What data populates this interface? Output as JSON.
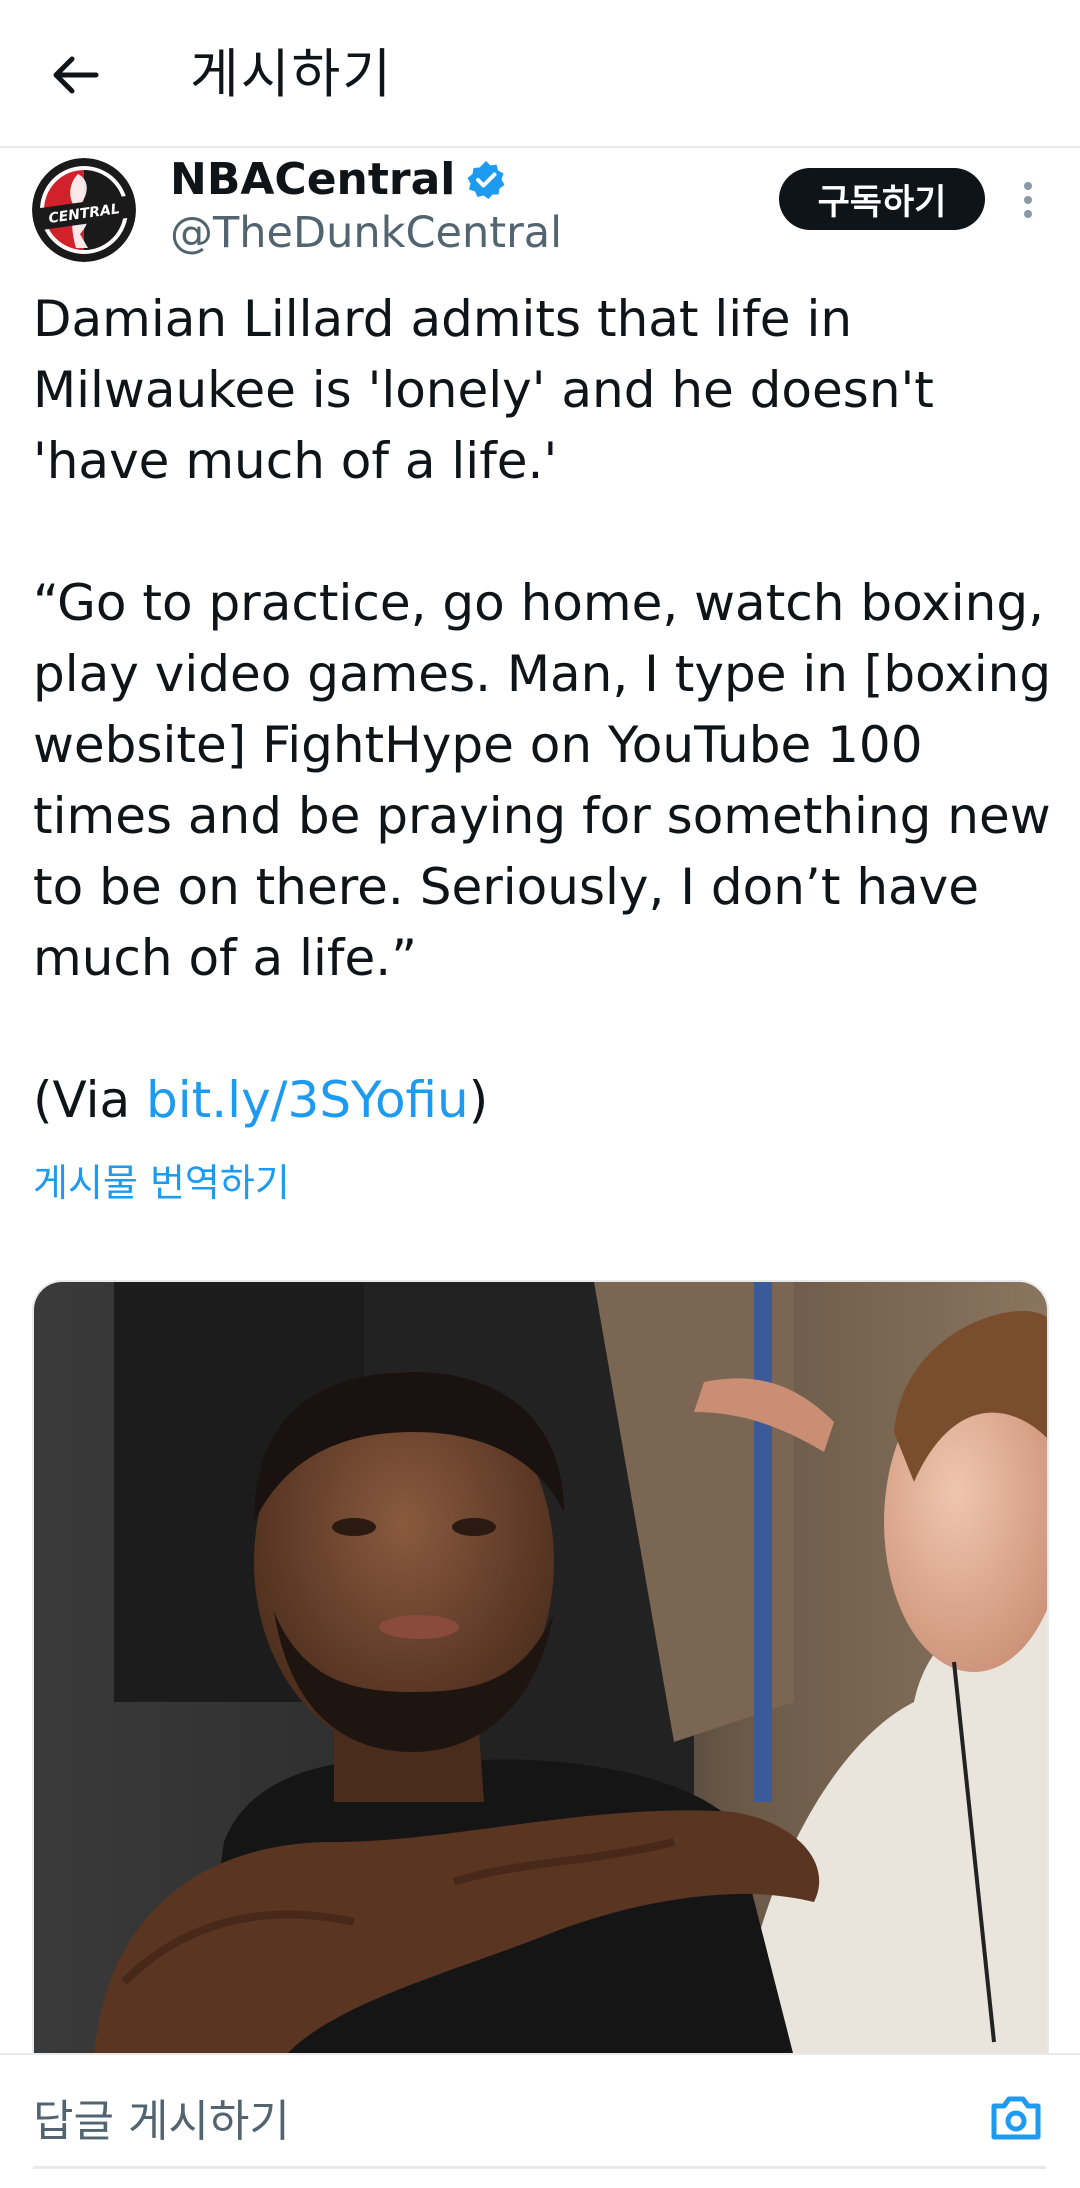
{
  "header": {
    "back_icon": "arrow-left-icon",
    "title": "게시하기"
  },
  "author": {
    "display_name": "NBACentral",
    "handle": "@TheDunkCentral",
    "avatar_text": "CENTRAL",
    "verified_icon": "verified-badge-icon",
    "verified_color": "#1d9bf0",
    "subscribe_label": "구독하기",
    "more_icon": "more-vertical-icon"
  },
  "tweet": {
    "text_main": "Damian Lillard admits that life in Milwaukee is 'lonely' and he doesn't 'have much of a life.'\n\n“Go to practice, go home, watch boxing, play video games. Man, I type in [boxing website] FightHype on YouTube 100 times and be praying for something new to be on there. Seriously, I don’t have much of a life.”\n\n(Via ",
    "link_text": "bit.ly/3SYofiu",
    "text_after_link": ")",
    "translate_label": "게시물 번역하기"
  },
  "media": {
    "photo_icon": "photo-of-player-courtside"
  },
  "reply": {
    "placeholder": "답글 게시하기",
    "camera_icon": "camera-icon"
  },
  "colors": {
    "accent": "#1d9bf0",
    "text": "#0f1419",
    "secondary": "#536471"
  }
}
